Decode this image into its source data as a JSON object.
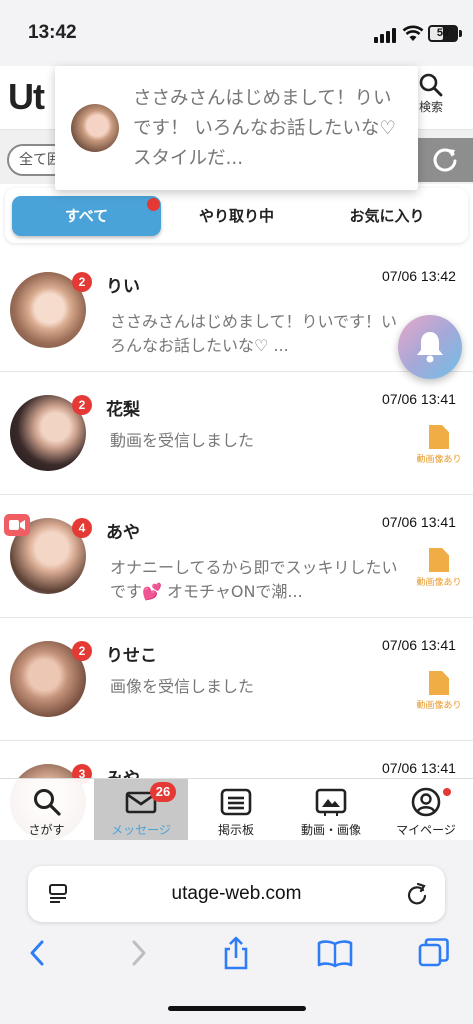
{
  "status_bar": {
    "time": "13:42",
    "battery": "50"
  },
  "header": {
    "logo": "Ut",
    "search_label": "検索"
  },
  "filter": {
    "sort_label": "全て囲"
  },
  "notification": {
    "text": "ささみさんはじめまして！りいです！ いろんなお話したいな♡ スタイルだ..."
  },
  "tabs": [
    {
      "label": "すべて",
      "active": true
    },
    {
      "label": "やり取り中",
      "active": false
    },
    {
      "label": "お気に入り",
      "active": false
    }
  ],
  "messages": [
    {
      "name": "りい",
      "badge": "2",
      "time": "07/06 13:42",
      "preview": "ささみさんはじめまして！りいです！いろんなお話したいな♡ ...",
      "attachment": ""
    },
    {
      "name": "花梨",
      "badge": "2",
      "time": "07/06 13:41",
      "preview": "動画を受信しました",
      "attachment": "動画像あり"
    },
    {
      "name": "あや",
      "badge": "4",
      "time": "07/06 13:41",
      "preview": "オナニーしてるから即でスッキリしたいです💕 オモチャONで潮...",
      "attachment": "動画像あり"
    },
    {
      "name": "りせこ",
      "badge": "2",
      "time": "07/06 13:41",
      "preview": "画像を受信しました",
      "attachment": "動画像あり"
    },
    {
      "name": "みや",
      "badge": "3",
      "time": "07/06 13:41",
      "preview": "",
      "attachment": ""
    }
  ],
  "bottom_nav": [
    {
      "label": "さがす",
      "icon": "search-icon"
    },
    {
      "label": "メッセージ",
      "icon": "mail-icon",
      "badge": "26",
      "active": true
    },
    {
      "label": "掲示板",
      "icon": "board-icon"
    },
    {
      "label": "動画・画像",
      "icon": "video-image-icon"
    },
    {
      "label": "マイページ",
      "icon": "user-icon"
    }
  ],
  "browser": {
    "url": "utage-web.com"
  },
  "colors": {
    "accent": "#4aa3d8",
    "badge": "#e53935",
    "file": "#f0ad45"
  }
}
